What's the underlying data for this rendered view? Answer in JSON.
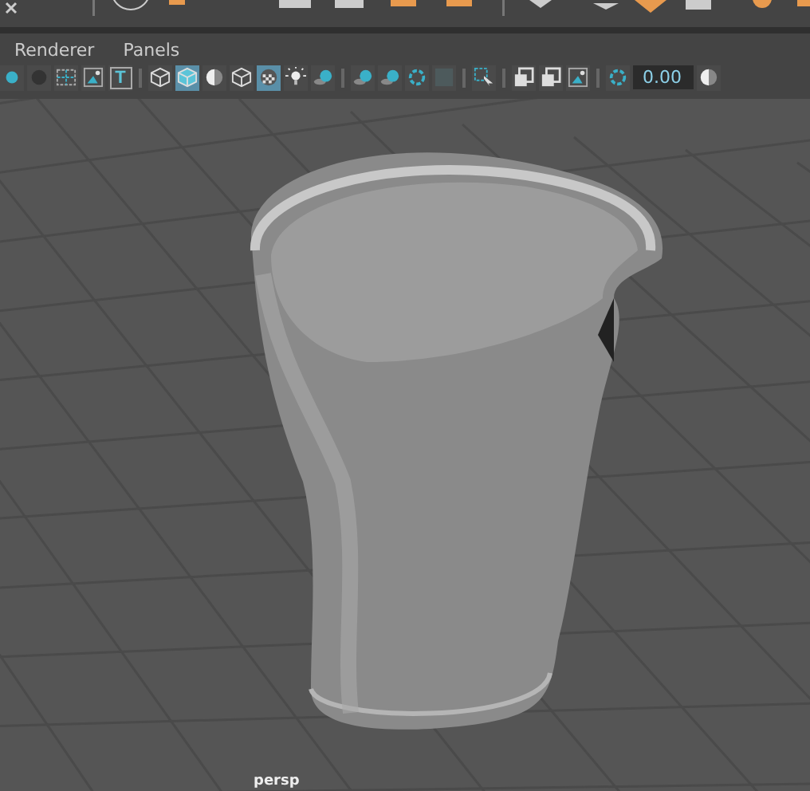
{
  "menu": [
    {
      "label": "Renderer"
    },
    {
      "label": "Panels"
    }
  ],
  "toolbar": [
    {
      "kind": "dot",
      "selected": false
    },
    {
      "kind": "sphere",
      "selected": false
    },
    {
      "kind": "frame",
      "selected": false
    },
    {
      "kind": "image",
      "selected": false
    },
    {
      "kind": "text",
      "label": "T",
      "selected": false
    },
    {
      "kind": "sep"
    },
    {
      "kind": "cube",
      "selected": false
    },
    {
      "kind": "cube",
      "selected": true
    },
    {
      "kind": "halfsphere",
      "selected": false
    },
    {
      "kind": "cube",
      "selected": false
    },
    {
      "kind": "checker",
      "selected": true
    },
    {
      "kind": "light",
      "selected": false
    },
    {
      "kind": "ball",
      "selected": false
    },
    {
      "kind": "sep"
    },
    {
      "kind": "ball",
      "selected": false
    },
    {
      "kind": "ball",
      "selected": false
    },
    {
      "kind": "ring",
      "selected": false
    },
    {
      "kind": "square",
      "selected": false
    },
    {
      "kind": "sep"
    },
    {
      "kind": "cursor",
      "selected": false
    },
    {
      "kind": "sep"
    },
    {
      "kind": "layers",
      "selected": false
    },
    {
      "kind": "layers",
      "selected": false
    },
    {
      "kind": "image",
      "selected": false
    },
    {
      "kind": "sep"
    },
    {
      "kind": "ring",
      "selected": false
    },
    {
      "kind": "field",
      "value": "0.00"
    },
    {
      "kind": "halfsphere",
      "selected": false
    }
  ],
  "viewport": {
    "camera_label": "persp"
  }
}
